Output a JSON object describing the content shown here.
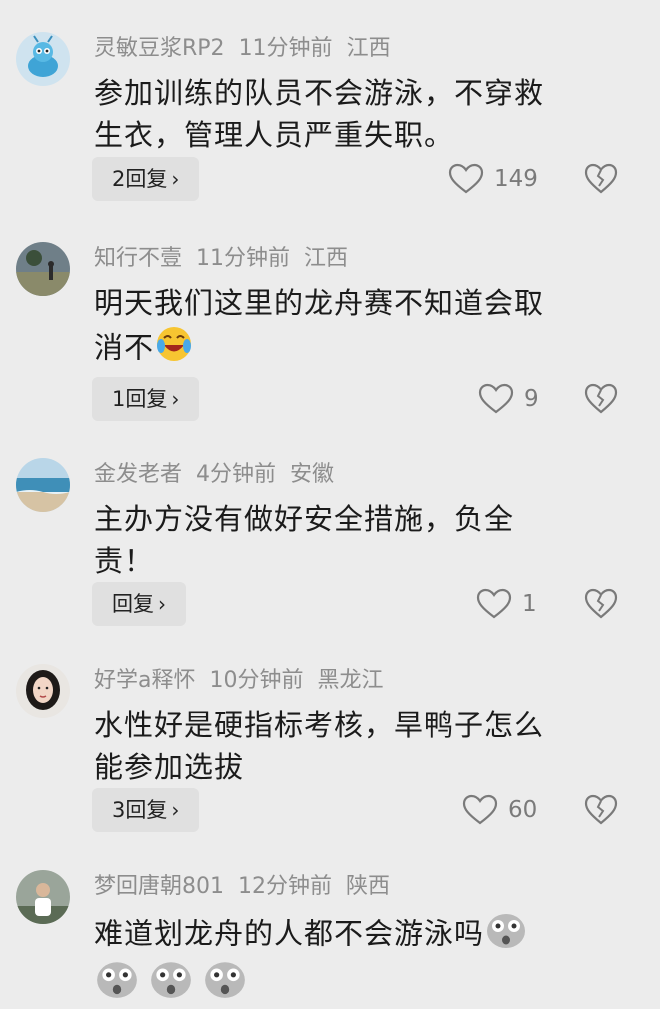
{
  "comments": [
    {
      "username": "灵敏豆浆RP2",
      "time": "11分钟前",
      "location": "江西",
      "text_line1": "参加训练的队员不会游泳，不穿救",
      "text_line2": "生衣，管理人员严重失职。",
      "reply_label": "2回复",
      "likes": "149",
      "avatar_icon": "cartoon-blue-alien-avatar"
    },
    {
      "username": "知行不壹",
      "time": "11分钟前",
      "location": "江西",
      "text_line1": "明天我们这里的龙舟赛不知道会取",
      "text_line2": "消不",
      "reply_label": "1回复",
      "likes": "9",
      "avatar_icon": "outdoor-photo-avatar",
      "emoji": "crying-laughing-emoji"
    },
    {
      "username": "金发老者",
      "time": "4分钟前",
      "location": "安徽",
      "text_line1": "主办方没有做好安全措施，负全",
      "text_line2": "责！",
      "reply_label": "回复",
      "likes": "1",
      "avatar_icon": "beach-photo-avatar"
    },
    {
      "username": "好学a释怀",
      "time": "10分钟前",
      "location": "黑龙江",
      "text_line1": "水性好是硬指标考核，旱鸭子怎么",
      "text_line2": "能参加选拔",
      "reply_label": "3回复",
      "likes": "60",
      "avatar_icon": "woman-portrait-avatar"
    },
    {
      "username": "梦回唐朝801",
      "time": "12分钟前",
      "location": "陕西",
      "text_line1": "难道划龙舟的人都不会游泳吗",
      "avatar_icon": "man-photo-avatar",
      "emoji": "shocked-face-emoji"
    }
  ],
  "icons": {
    "like": "heart-outline-icon",
    "dislike": "broken-heart-icon",
    "chevron": "chevron-right-icon"
  },
  "colors": {
    "background": "#ececec",
    "meta_text": "#8d8d8d",
    "body_text": "#1b1b1b",
    "reply_bg": "#e0e0e0"
  }
}
